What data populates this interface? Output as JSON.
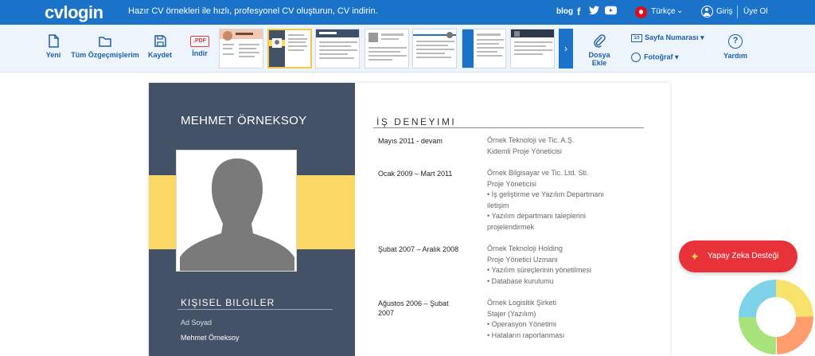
{
  "header": {
    "logo": "cvlogin",
    "tagline": "Hazır CV örnekleri ile hızlı, profesyonel CV oluşturun, CV indirin.",
    "blog": "blog",
    "language": "Türkçe",
    "login": "Giriş",
    "signup": "Üye Ol"
  },
  "toolbar": {
    "new": "Yeni",
    "all_cvs": "Tüm Özgeçmişlerim",
    "save": "Kaydet",
    "pdf_badge": ".PDF",
    "download": "İndir",
    "attach_line1": "Dosya",
    "attach_line2": "Ekle",
    "page_number": "Sayfa Numarası",
    "photo": "Fotoğraf",
    "help": "Yardım"
  },
  "cv": {
    "name": "MEHMET ÖRNEKSOY",
    "personal_title": "KIŞISEL BILGILER",
    "fullname_label": "Ad Soyad",
    "fullname_value": "Mehmet Örneksoy",
    "experience_title": "İŞ DENEYIMI",
    "experience": [
      {
        "date": "Mayıs 2011 - devam",
        "lines": [
          "Örnek Teknoloji ve Tic. A.Ş.",
          "Kidemli Proje Yöneticisi"
        ]
      },
      {
        "date": "Ocak 2009 – Mart 2011",
        "lines": [
          "Örnek Bilgisayar ve Tic. Ltd. Sti.",
          "Proje Yöneticisi",
          "• İş geliştirme ve Yazılım Departmanı",
          "iletişim",
          "• Yazılım departmanı taleplerini",
          "projelendirmek"
        ]
      },
      {
        "date": "Şubat 2007 – Aralık 2008",
        "lines": [
          "Örnek Teknoloji Holding",
          "Proje Yönetici Uzmanı",
          "• Yazılım süreçlerinin yönetilmesi",
          "• Database kurulumu"
        ]
      },
      {
        "date": "Ağustos 2006 – Şubat 2007",
        "lines": [
          "Örnek Logisitik Şirketi",
          "Stajer (Yazılım)",
          "• Operasyon Yönetimi",
          "• Hataların raporlanması"
        ]
      }
    ]
  },
  "ai_button": "Yapay Zeka Desteği",
  "colors": {
    "brand": "#1a73c8",
    "sidebar": "#435266",
    "band": "#fbd766",
    "ai": "#e8323a"
  }
}
